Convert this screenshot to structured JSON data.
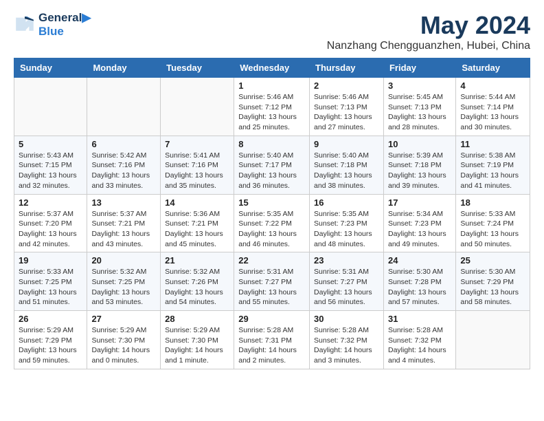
{
  "logo": {
    "line1": "General",
    "line2": "Blue"
  },
  "title": "May 2024",
  "location": "Nanzhang Chengguanzhen, Hubei, China",
  "headers": [
    "Sunday",
    "Monday",
    "Tuesday",
    "Wednesday",
    "Thursday",
    "Friday",
    "Saturday"
  ],
  "weeks": [
    [
      {
        "day": "",
        "info": ""
      },
      {
        "day": "",
        "info": ""
      },
      {
        "day": "",
        "info": ""
      },
      {
        "day": "1",
        "info": "Sunrise: 5:46 AM\nSunset: 7:12 PM\nDaylight: 13 hours\nand 25 minutes."
      },
      {
        "day": "2",
        "info": "Sunrise: 5:46 AM\nSunset: 7:13 PM\nDaylight: 13 hours\nand 27 minutes."
      },
      {
        "day": "3",
        "info": "Sunrise: 5:45 AM\nSunset: 7:13 PM\nDaylight: 13 hours\nand 28 minutes."
      },
      {
        "day": "4",
        "info": "Sunrise: 5:44 AM\nSunset: 7:14 PM\nDaylight: 13 hours\nand 30 minutes."
      }
    ],
    [
      {
        "day": "5",
        "info": "Sunrise: 5:43 AM\nSunset: 7:15 PM\nDaylight: 13 hours\nand 32 minutes."
      },
      {
        "day": "6",
        "info": "Sunrise: 5:42 AM\nSunset: 7:16 PM\nDaylight: 13 hours\nand 33 minutes."
      },
      {
        "day": "7",
        "info": "Sunrise: 5:41 AM\nSunset: 7:16 PM\nDaylight: 13 hours\nand 35 minutes."
      },
      {
        "day": "8",
        "info": "Sunrise: 5:40 AM\nSunset: 7:17 PM\nDaylight: 13 hours\nand 36 minutes."
      },
      {
        "day": "9",
        "info": "Sunrise: 5:40 AM\nSunset: 7:18 PM\nDaylight: 13 hours\nand 38 minutes."
      },
      {
        "day": "10",
        "info": "Sunrise: 5:39 AM\nSunset: 7:18 PM\nDaylight: 13 hours\nand 39 minutes."
      },
      {
        "day": "11",
        "info": "Sunrise: 5:38 AM\nSunset: 7:19 PM\nDaylight: 13 hours\nand 41 minutes."
      }
    ],
    [
      {
        "day": "12",
        "info": "Sunrise: 5:37 AM\nSunset: 7:20 PM\nDaylight: 13 hours\nand 42 minutes."
      },
      {
        "day": "13",
        "info": "Sunrise: 5:37 AM\nSunset: 7:21 PM\nDaylight: 13 hours\nand 43 minutes."
      },
      {
        "day": "14",
        "info": "Sunrise: 5:36 AM\nSunset: 7:21 PM\nDaylight: 13 hours\nand 45 minutes."
      },
      {
        "day": "15",
        "info": "Sunrise: 5:35 AM\nSunset: 7:22 PM\nDaylight: 13 hours\nand 46 minutes."
      },
      {
        "day": "16",
        "info": "Sunrise: 5:35 AM\nSunset: 7:23 PM\nDaylight: 13 hours\nand 48 minutes."
      },
      {
        "day": "17",
        "info": "Sunrise: 5:34 AM\nSunset: 7:23 PM\nDaylight: 13 hours\nand 49 minutes."
      },
      {
        "day": "18",
        "info": "Sunrise: 5:33 AM\nSunset: 7:24 PM\nDaylight: 13 hours\nand 50 minutes."
      }
    ],
    [
      {
        "day": "19",
        "info": "Sunrise: 5:33 AM\nSunset: 7:25 PM\nDaylight: 13 hours\nand 51 minutes."
      },
      {
        "day": "20",
        "info": "Sunrise: 5:32 AM\nSunset: 7:25 PM\nDaylight: 13 hours\nand 53 minutes."
      },
      {
        "day": "21",
        "info": "Sunrise: 5:32 AM\nSunset: 7:26 PM\nDaylight: 13 hours\nand 54 minutes."
      },
      {
        "day": "22",
        "info": "Sunrise: 5:31 AM\nSunset: 7:27 PM\nDaylight: 13 hours\nand 55 minutes."
      },
      {
        "day": "23",
        "info": "Sunrise: 5:31 AM\nSunset: 7:27 PM\nDaylight: 13 hours\nand 56 minutes."
      },
      {
        "day": "24",
        "info": "Sunrise: 5:30 AM\nSunset: 7:28 PM\nDaylight: 13 hours\nand 57 minutes."
      },
      {
        "day": "25",
        "info": "Sunrise: 5:30 AM\nSunset: 7:29 PM\nDaylight: 13 hours\nand 58 minutes."
      }
    ],
    [
      {
        "day": "26",
        "info": "Sunrise: 5:29 AM\nSunset: 7:29 PM\nDaylight: 13 hours\nand 59 minutes."
      },
      {
        "day": "27",
        "info": "Sunrise: 5:29 AM\nSunset: 7:30 PM\nDaylight: 14 hours\nand 0 minutes."
      },
      {
        "day": "28",
        "info": "Sunrise: 5:29 AM\nSunset: 7:30 PM\nDaylight: 14 hours\nand 1 minute."
      },
      {
        "day": "29",
        "info": "Sunrise: 5:28 AM\nSunset: 7:31 PM\nDaylight: 14 hours\nand 2 minutes."
      },
      {
        "day": "30",
        "info": "Sunrise: 5:28 AM\nSunset: 7:32 PM\nDaylight: 14 hours\nand 3 minutes."
      },
      {
        "day": "31",
        "info": "Sunrise: 5:28 AM\nSunset: 7:32 PM\nDaylight: 14 hours\nand 4 minutes."
      },
      {
        "day": "",
        "info": ""
      }
    ]
  ]
}
